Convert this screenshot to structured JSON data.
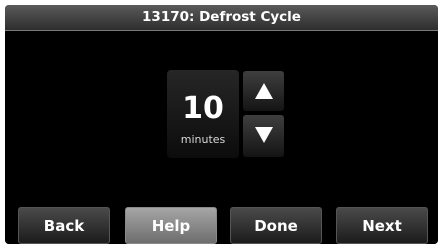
{
  "header": {
    "title": "13170: Defrost Cycle"
  },
  "setting": {
    "value": "10",
    "unit": "minutes"
  },
  "controls": {
    "increase_icon": "triangle-up-icon",
    "decrease_icon": "triangle-down-icon"
  },
  "footer": {
    "back_label": "Back",
    "help_label": "Help",
    "done_label": "Done",
    "next_label": "Next"
  },
  "colors": {
    "background": "#000000",
    "text": "#ffffff",
    "help_button": "#8a8a8a"
  }
}
